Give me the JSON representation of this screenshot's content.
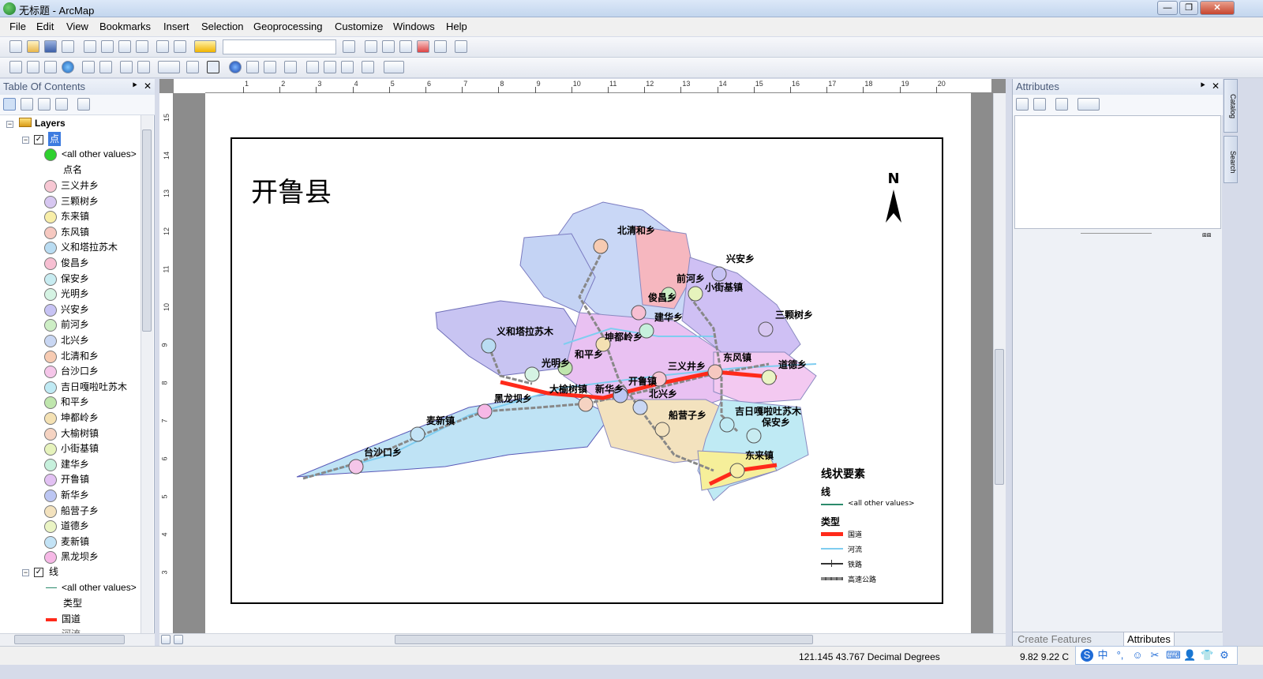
{
  "window": {
    "title": "无标题 - ArcMap",
    "controls": [
      "—",
      "❐",
      "✕"
    ]
  },
  "menu": [
    "File",
    "Edit",
    "View",
    "Bookmarks",
    "Insert",
    "Selection",
    "Geoprocessing",
    "Customize",
    "Windows",
    "Help"
  ],
  "toc": {
    "title": "Table Of Contents",
    "pin": "⯈",
    "close": "✕",
    "layers_label": "Layers",
    "point_layer": {
      "name": "点",
      "all_other_values": "<all other values>",
      "all_other_color": "#2fd12f",
      "field_label": "点名",
      "classes": [
        {
          "label": "三义井乡",
          "color": "#f7c7d3"
        },
        {
          "label": "三颗树乡",
          "color": "#d7c7f1"
        },
        {
          "label": "东来镇",
          "color": "#f8eea8"
        },
        {
          "label": "东风镇",
          "color": "#f6c8c0"
        },
        {
          "label": "义和塔拉苏木",
          "color": "#b9dcf2"
        },
        {
          "label": "俊昌乡",
          "color": "#f7bfd2"
        },
        {
          "label": "保安乡",
          "color": "#c8ecf1"
        },
        {
          "label": "光明乡",
          "color": "#d5f3e3"
        },
        {
          "label": "兴安乡",
          "color": "#c7c3f4"
        },
        {
          "label": "前河乡",
          "color": "#cdeec5"
        },
        {
          "label": "北兴乡",
          "color": "#c9d7f3"
        },
        {
          "label": "北清和乡",
          "color": "#f7cbb2"
        },
        {
          "label": "台沙口乡",
          "color": "#f5c6e9"
        },
        {
          "label": "吉日嘎啦吐苏木",
          "color": "#bfeaf4"
        },
        {
          "label": "和平乡",
          "color": "#bfe6ad"
        },
        {
          "label": "坤都岭乡",
          "color": "#f4e1b3"
        },
        {
          "label": "大榆树镇",
          "color": "#f5d3c2"
        },
        {
          "label": "小街基镇",
          "color": "#e6f3bc"
        },
        {
          "label": "建华乡",
          "color": "#c6f0dc"
        },
        {
          "label": "开鲁镇",
          "color": "#e2c1f3"
        },
        {
          "label": "新华乡",
          "color": "#bcc6f3"
        },
        {
          "label": "船营子乡",
          "color": "#f3e2be"
        },
        {
          "label": "道德乡",
          "color": "#eaf4c4"
        },
        {
          "label": "麦新镇",
          "color": "#c3e3f6"
        },
        {
          "label": "黑龙坝乡",
          "color": "#f6b8e6"
        }
      ]
    },
    "line_layer": {
      "name": "线",
      "all_other_values": "<all other values>",
      "field_label": "类型",
      "classes": [
        {
          "label": "国道",
          "color": "#ff2a1a"
        },
        {
          "label": "河流",
          "color": "#7fcdf0"
        }
      ]
    }
  },
  "layout": {
    "map_title": "开鲁县",
    "north_label": "N",
    "ruler_top": [
      "1",
      "2",
      "3",
      "4",
      "5",
      "6",
      "7",
      "8",
      "9",
      "10",
      "11",
      "12",
      "13",
      "14",
      "15",
      "16",
      "17",
      "18",
      "19",
      "20"
    ],
    "ruler_left": [
      "15",
      "14",
      "13",
      "12",
      "11",
      "10",
      "9",
      "8",
      "7",
      "6",
      "5",
      "4",
      "3"
    ],
    "towns": [
      "北清和乡",
      "兴安乡",
      "前河乡",
      "小街基镇",
      "俊昌乡",
      "三颗树乡",
      "建华乡",
      "义和塔拉苏木",
      "坤都岭乡",
      "和平乡",
      "东风镇",
      "光明乡",
      "三义井乡",
      "道德乡",
      "开鲁镇",
      "大榆树镇",
      "新华乡",
      "黑龙坝乡",
      "北兴乡",
      "船营子乡",
      "吉日嘎啦吐苏木",
      "麦新镇",
      "保安乡",
      "台沙口乡",
      "东来镇"
    ],
    "legend": {
      "heading": "线状要素",
      "layer": "线",
      "all_other_values": "<all other values>",
      "field": "类型",
      "items": [
        {
          "label": "国道",
          "color": "#ff2a1a"
        },
        {
          "label": "河流",
          "color": "#7fcdf0"
        },
        {
          "label": "铁路",
          "color": "#333333"
        },
        {
          "label": "高速公路",
          "color": "#888888"
        }
      ]
    }
  },
  "attributes": {
    "title": "Attributes",
    "tabs": [
      "Create Features",
      "Attributes"
    ]
  },
  "side_tabs": [
    "Catalog",
    "Search"
  ],
  "status": {
    "coords": "121.145  43.767 Decimal Degrees",
    "page_coords": "9.82  9.22 C"
  },
  "tray": [
    "中",
    "°,",
    "☺",
    "✂",
    "⌨",
    "👤",
    "👕",
    "⚙"
  ]
}
